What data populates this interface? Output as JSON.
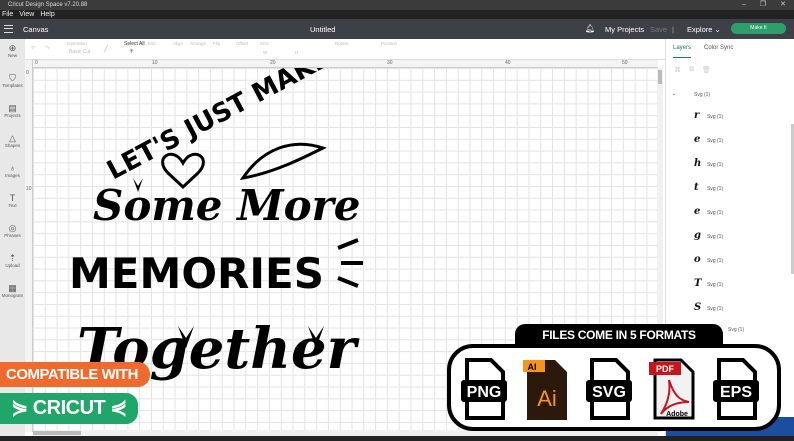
{
  "window": {
    "title": "Cricut Design Space  v7.20.88",
    "controls": [
      "–",
      "❐",
      "✕"
    ]
  },
  "menu": [
    "File",
    "View",
    "Help"
  ],
  "header": {
    "section": "Canvas",
    "document": "Untitled",
    "my_projects": "My Projects",
    "save": "Save",
    "explore": "Explore",
    "make_it": "Make It"
  },
  "toolbar": {
    "operation": "Operation",
    "operation_value": "Basic Cut",
    "select_all": "Select All",
    "edit": "Edit",
    "align": "Align",
    "arrange": "Arrange",
    "flip": "Flip",
    "offset": "Offset",
    "size": "Size",
    "size_w": "W",
    "size_h": "H",
    "rotate": "Rotate",
    "position": "Position"
  },
  "sidebar": [
    {
      "label": "New",
      "icon": "⊕"
    },
    {
      "label": "Templates",
      "icon": "👕"
    },
    {
      "label": "Projects",
      "icon": "▤"
    },
    {
      "label": "Shapes",
      "icon": "△"
    },
    {
      "label": "Images",
      "icon": "💡"
    },
    {
      "label": "Text",
      "icon": "T"
    },
    {
      "label": "Phrases",
      "icon": "💬"
    },
    {
      "label": "Upload",
      "icon": "⇡"
    },
    {
      "label": "Monogram",
      "icon": "▦"
    }
  ],
  "ruler": {
    "top": [
      "0",
      "10",
      "20",
      "30",
      "40",
      "50"
    ],
    "left": [
      "0",
      "10"
    ]
  },
  "panel": {
    "tabs": [
      "Layers",
      "Color Sync"
    ],
    "group": "Svg (1)",
    "layers": [
      {
        "glyph": "r",
        "name": "Svg (1)"
      },
      {
        "glyph": "e",
        "name": "Svg (1)"
      },
      {
        "glyph": "h",
        "name": "Svg (1)"
      },
      {
        "glyph": "t",
        "name": "Svg (1)"
      },
      {
        "glyph": "e",
        "name": "Svg (1)"
      },
      {
        "glyph": "g",
        "name": "Svg (1)"
      },
      {
        "glyph": "o",
        "name": "Svg (1)"
      },
      {
        "glyph": "T",
        "name": "Svg (1)"
      },
      {
        "glyph": "S",
        "name": "Svg (1)"
      },
      {
        "glyph": "",
        "name": "Svg (1)"
      }
    ]
  },
  "design": {
    "line1": "LET'S JUST MAKE",
    "line2": "Some More",
    "line3": "MEMORIES",
    "line4": "Together"
  },
  "promo": {
    "compatible": "COMPATIBLE WITH",
    "cricut": "CRICUT",
    "formats_title": "FILES COME IN 5 FORMATS",
    "formats": [
      "PNG",
      "Ai",
      "SVG",
      "PDF",
      "EPS"
    ],
    "ai_tag": "AI",
    "adobe": "Adobe"
  },
  "colors": {
    "accent": "#2e9e6b",
    "orange": "#ef6a2c",
    "green": "#21a66a",
    "header": "#3d4046"
  }
}
